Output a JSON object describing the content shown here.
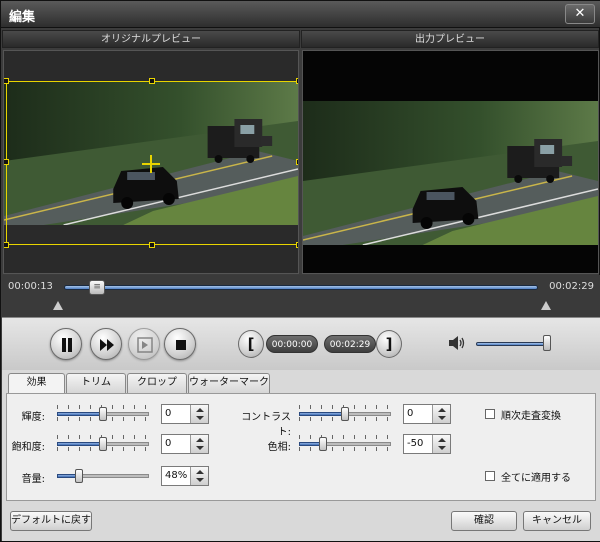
{
  "window": {
    "title": "編集",
    "close_glyph": "✕"
  },
  "preview": {
    "original_label": "オリジナルプレビュー",
    "output_label": "出力プレビュー"
  },
  "timeline": {
    "start_time": "00:00:13",
    "end_time": "00:02:29",
    "position_fraction": 0.07
  },
  "playback": {
    "trim_start": "00:00:00",
    "trim_end": "00:02:29",
    "bracket_open": "[",
    "bracket_close": "]"
  },
  "tabs": [
    {
      "label": "効果"
    },
    {
      "label": "トリム"
    },
    {
      "label": "クロップ"
    },
    {
      "label": "ウォーターマーク"
    }
  ],
  "effects": {
    "brightness": {
      "label": "輝度:",
      "value": "0"
    },
    "saturation": {
      "label": "飽和度:",
      "value": "0"
    },
    "volume": {
      "label": "音量:",
      "value": "48%"
    },
    "contrast": {
      "label": "コントラスト:",
      "value": "0"
    },
    "hue": {
      "label": "色相:",
      "value": "-50"
    },
    "deinterlace": {
      "label": "順次走査変換",
      "checked": false
    },
    "apply_all": {
      "label": "全てに適用する",
      "checked": false
    }
  },
  "footer": {
    "default_label": "デフォルトに戻す",
    "ok_label": "確認",
    "cancel_label": "キャンセル"
  },
  "colors": {
    "crop_box": "#e8d400",
    "slider_fill": "#4f7fc4"
  }
}
